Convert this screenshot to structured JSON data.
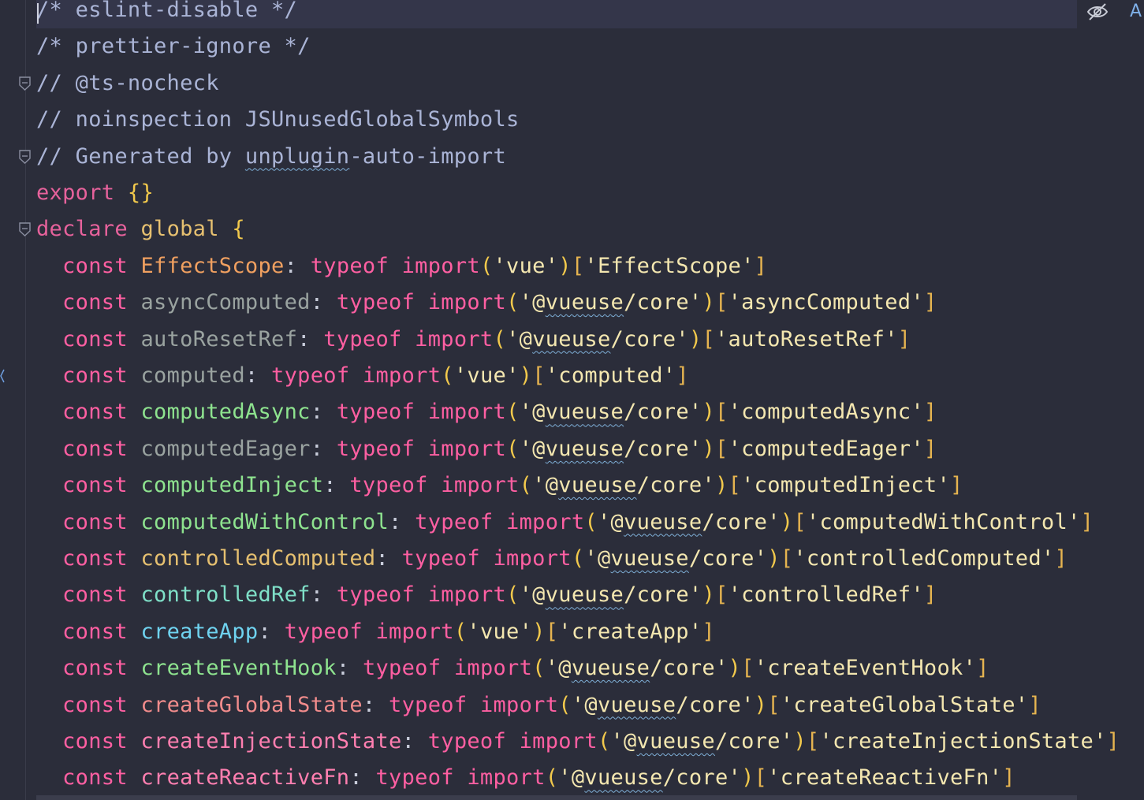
{
  "editor": {
    "lines": [
      {
        "tokens": [
          {
            "t": "/* eslint-disable */",
            "c": "c-comment"
          }
        ],
        "current": true
      },
      {
        "tokens": [
          {
            "t": "/* prettier-ignore */",
            "c": "c-comment"
          }
        ]
      },
      {
        "tokens": [
          {
            "t": "// @ts-nocheck",
            "c": "c-comment"
          }
        ],
        "fold": true
      },
      {
        "tokens": [
          {
            "t": "// noinspection JSUnusedGlobalSymbols",
            "c": "c-comment"
          }
        ]
      },
      {
        "tokens": [
          {
            "t": "// Generated by ",
            "c": "c-comment"
          },
          {
            "t": "unplugin",
            "c": "c-comment wavy"
          },
          {
            "t": "-auto-import",
            "c": "c-comment"
          }
        ],
        "fold": true
      },
      {
        "tokens": [
          {
            "t": "export ",
            "c": "c-kw2"
          },
          {
            "t": "{}",
            "c": "c-brace"
          }
        ]
      },
      {
        "tokens": [
          {
            "t": "declare ",
            "c": "c-kw2"
          },
          {
            "t": "global ",
            "c": "c-id-gold"
          },
          {
            "t": "{",
            "c": "c-brace"
          }
        ],
        "fold": true
      },
      {
        "indent": true,
        "name": "EffectScope",
        "nameClass": "c-id-orange",
        "module": "vue",
        "key": "EffectScope"
      },
      {
        "indent": true,
        "name": "asyncComputed",
        "nameClass": "c-id-gray",
        "module": "@vueuse/core",
        "key": "asyncComputed"
      },
      {
        "indent": true,
        "name": "autoResetRef",
        "nameClass": "c-id-gray",
        "module": "@vueuse/core",
        "key": "autoResetRef"
      },
      {
        "indent": true,
        "name": "computed",
        "nameClass": "c-id-gray",
        "module": "vue",
        "key": "computed"
      },
      {
        "indent": true,
        "name": "computedAsync",
        "nameClass": "c-id-green",
        "module": "@vueuse/core",
        "key": "computedAsync"
      },
      {
        "indent": true,
        "name": "computedEager",
        "nameClass": "c-id-gray",
        "module": "@vueuse/core",
        "key": "computedEager"
      },
      {
        "indent": true,
        "name": "computedInject",
        "nameClass": "c-id-green",
        "module": "@vueuse/core",
        "key": "computedInject"
      },
      {
        "indent": true,
        "name": "computedWithControl",
        "nameClass": "c-id-green",
        "module": "@vueuse/core",
        "key": "computedWithControl"
      },
      {
        "indent": true,
        "name": "controlledComputed",
        "nameClass": "c-id-gold",
        "module": "@vueuse/core",
        "key": "controlledComputed"
      },
      {
        "indent": true,
        "name": "controlledRef",
        "nameClass": "c-id-teal",
        "module": "@vueuse/core",
        "key": "controlledRef"
      },
      {
        "indent": true,
        "name": "createApp",
        "nameClass": "c-id-cyan",
        "module": "vue",
        "key": "createApp"
      },
      {
        "indent": true,
        "name": "createEventHook",
        "nameClass": "c-id-green",
        "module": "@vueuse/core",
        "key": "createEventHook"
      },
      {
        "indent": true,
        "name": "createGlobalState",
        "nameClass": "c-id-salmon",
        "module": "@vueuse/core",
        "key": "createGlobalState"
      },
      {
        "indent": true,
        "name": "createInjectionState",
        "nameClass": "c-id-pink",
        "module": "@vueuse/core",
        "key": "createInjectionState"
      },
      {
        "indent": true,
        "name": "createReactiveFn",
        "nameClass": "c-id-pink",
        "module": "@vueuse/core",
        "key": "createReactiveFn"
      }
    ],
    "kw_const": "const",
    "kw_typeof": "typeof",
    "kw_import": "import"
  },
  "toolbar": {
    "eye_icon": "eye-crossed-icon",
    "reader_mode_label": "A"
  },
  "colors": {
    "background": "#2b2d3a",
    "current_line": "#34364a",
    "keyword": "#ff5fa2",
    "string": "#f4e7b0",
    "bracket": "#f2c94c",
    "comment": "#aab4d6"
  }
}
